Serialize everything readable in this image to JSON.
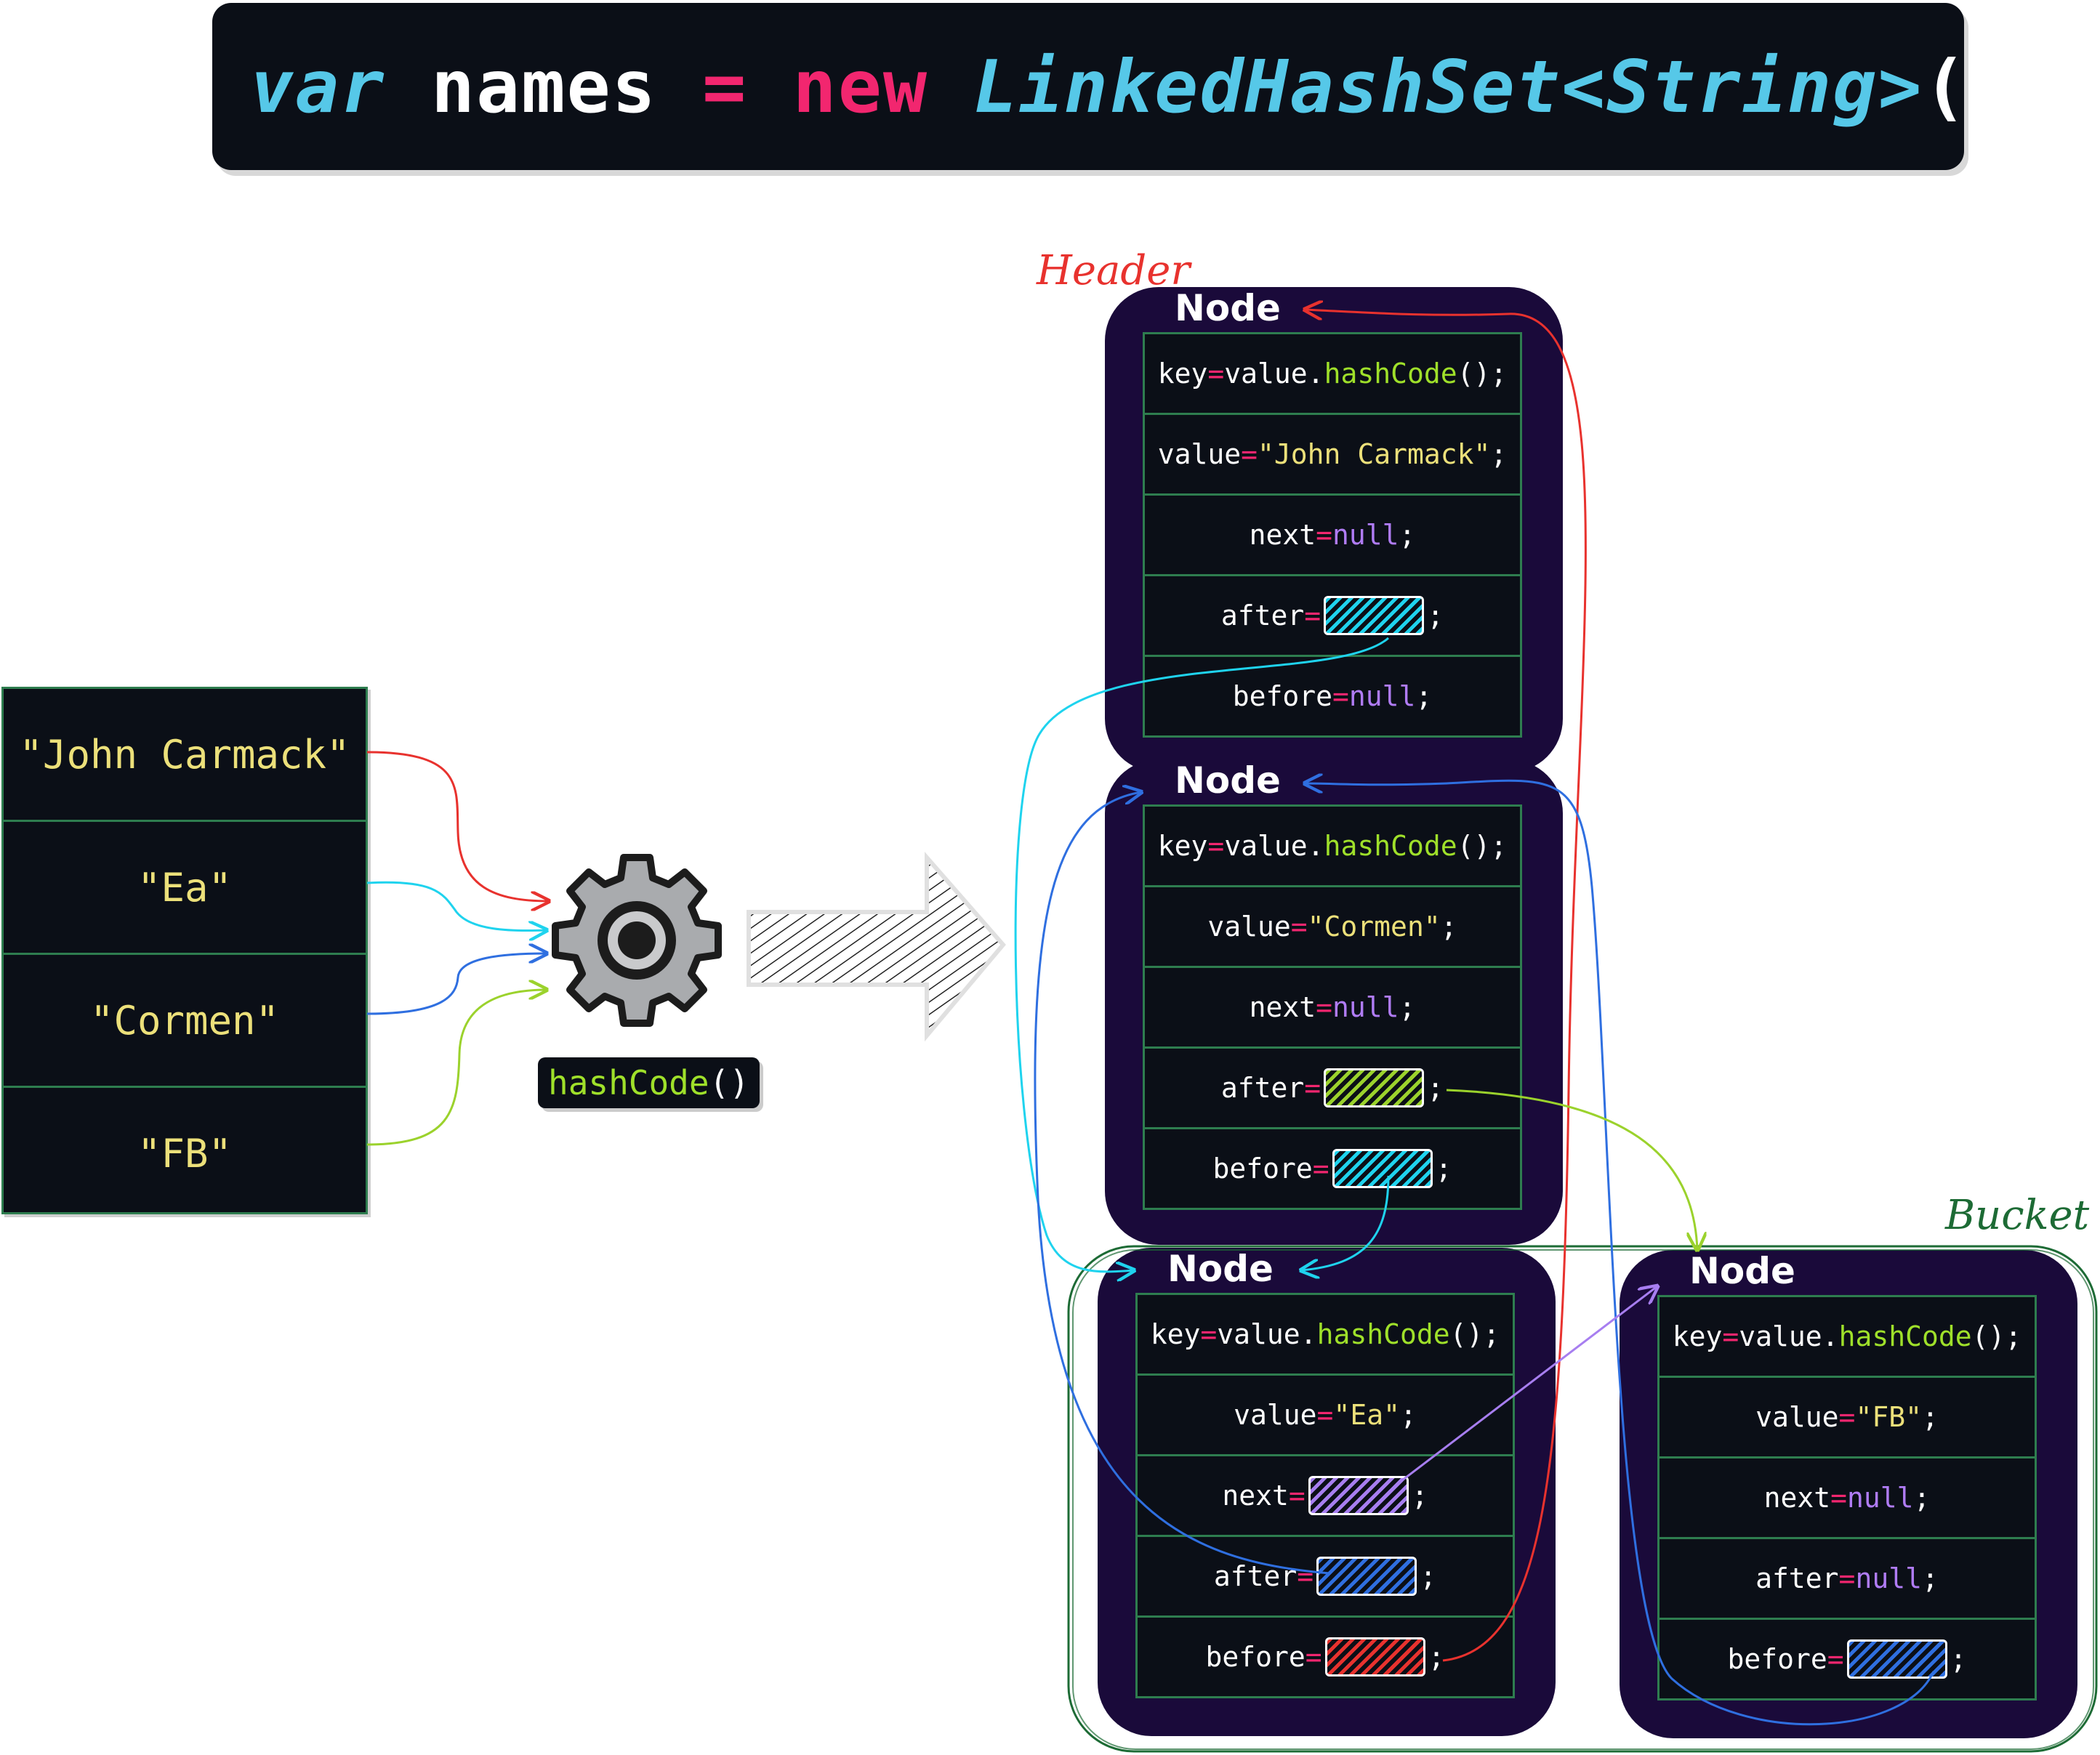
{
  "code": {
    "var_kw": "var",
    "name": " names ",
    "eq": "=",
    "new_kw": " new ",
    "type": "LinkedHashSet<String>",
    "tail": "();"
  },
  "inputs": [
    "\"John Carmack\"",
    "\"Ea\"",
    "\"Cormen\"",
    "\"FB\""
  ],
  "hash_fn": {
    "name": "hashCode",
    "parens": "()"
  },
  "labels": {
    "header": "Header",
    "bucket": "Bucket"
  },
  "node_title": "Node",
  "fields": {
    "key": "key",
    "value": "value",
    "next": "next",
    "after": "after",
    "before": "before",
    "eq": "=",
    "hash_call_prefix": "value.",
    "hash_call_method": "hashCode",
    "hash_call_suffix": "();",
    "null_kw": "null",
    "semi": ";"
  },
  "nodes": [
    {
      "id": "node-john",
      "value": "\"John Carmack\"",
      "next": "null",
      "after": "pointer",
      "before": "null"
    },
    {
      "id": "node-cormen",
      "value": "\"Cormen\"",
      "next": "null",
      "after": "pointer",
      "before": "pointer"
    },
    {
      "id": "node-ea",
      "value": "\"Ea\"",
      "next": "pointer",
      "after": "pointer",
      "before": "pointer"
    },
    {
      "id": "node-fb",
      "value": "\"FB\"",
      "next": "null",
      "after": "null",
      "before": "pointer"
    }
  ],
  "colors": {
    "john": "#e8322e",
    "ea": "#1fd3ee",
    "cormen": "#2f6fe0",
    "fb": "#9bd22c",
    "next_ptr": "#a77ef0",
    "bucket": "#1d6b35",
    "header": "#e8322e"
  }
}
